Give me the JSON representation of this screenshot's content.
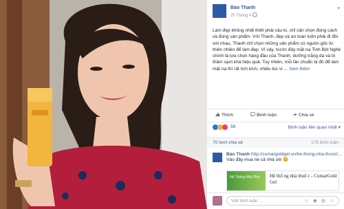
{
  "post": {
    "author": "Bảo Thanh",
    "time": "25 Tháng 4",
    "body": "Làm đẹp không nhất thiết phải cầu kì, chỉ cần chọn đúng cách và đúng sản phẩm. Với Thanh, đẹp và an toàn luôn phải đi đôi với nhau, Thanh chỉ chọn những sản phẩm có nguồn gốc từ thiên nhiên để làm đẹp. Vì vậy, trước đây mặt nạ Tinh Bột Nghệ chính là lựa chọn hàng đầu của Thanh, dưỡng trắng da và trị thâm sạm khá hiệu quả. Tuy nhiên, mỗi lần chuẩn bị đồ để làm mặt nạ thì rất lích kích, nhiều lúc vì ...",
    "see_more": "Xem thêm"
  },
  "actions": {
    "like": "Thích",
    "comment": "Bình luận",
    "share": "Chia sẻ"
  },
  "reactions": {
    "count": "5K",
    "filter": "Bình luận liên quan nhất ▾"
  },
  "stats": {
    "shares": "70 lượt chia sẻ",
    "comments": "175 bình luận"
  },
  "comment": {
    "author": "Bảo Thanh",
    "link": "http://cumargoldgel.vn/he-thong-nha-thuoc/...",
    "text": "Vào đây mua nè cả nhà ơiii 😊",
    "card_thumb": "Hệ Thống Nhà Phối",
    "card_title": "Hệ thố ng nhà thuố c - CumarGold Gel"
  },
  "footer": {
    "placeholder": "Viết bình luận ...",
    "icons": "☺ ◉ ◍ ☺"
  },
  "colors": {
    "link": "#365899",
    "muted": "#90949c"
  }
}
